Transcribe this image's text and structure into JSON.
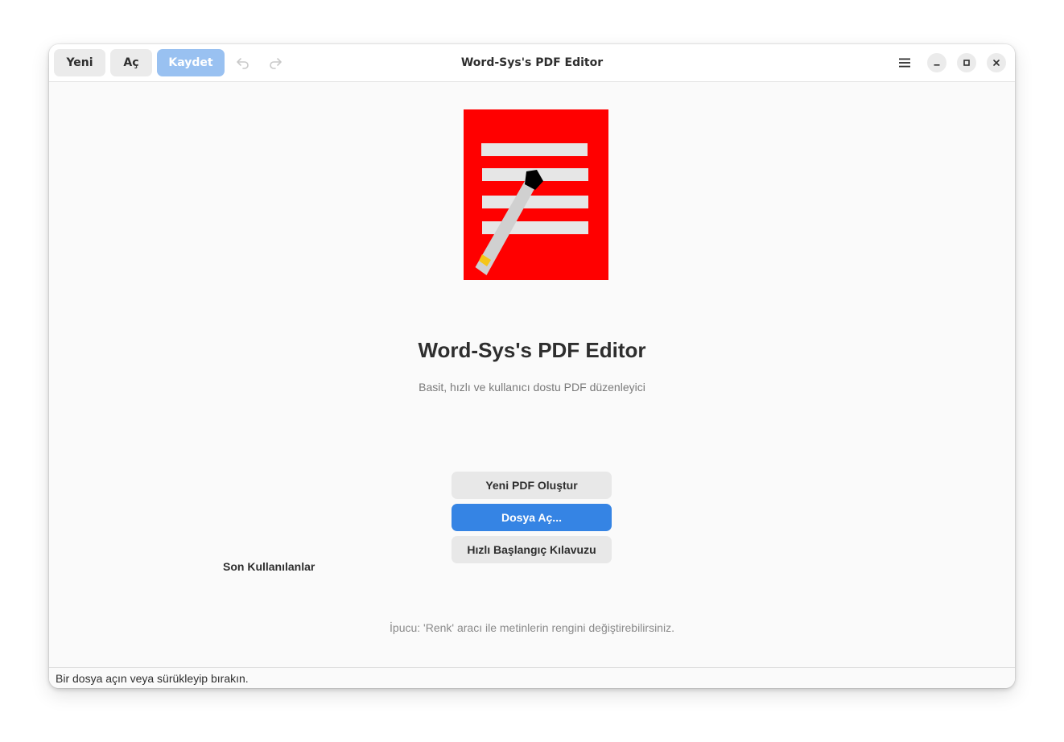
{
  "window": {
    "title": "Word-Sys's PDF Editor"
  },
  "toolbar": {
    "new_label": "Yeni",
    "open_label": "Aç",
    "save_label": "Kaydet"
  },
  "icons": {
    "undo": "undo-icon",
    "redo": "redo-icon",
    "menu": "hamburger-menu-icon",
    "minimize": "minimize-icon",
    "maximize": "maximize-icon",
    "close": "close-icon",
    "logo": "pdf-document-pen-logo"
  },
  "welcome": {
    "title": "Word-Sys's PDF Editor",
    "subtitle": "Basit, hızlı ve kullanıcı dostu PDF düzenleyici",
    "buttons": {
      "create": "Yeni PDF Oluştur",
      "open": "Dosya Aç...",
      "quickstart": "Hızlı Başlangıç Kılavuzu"
    },
    "recent_heading": "Son Kullanılanlar",
    "tip": "İpucu: 'Renk' aracı ile metinlerin rengini değiştirebilirsiniz."
  },
  "statusbar": {
    "text": "Bir dosya açın veya sürükleyip bırakın."
  },
  "colors": {
    "accent": "#3584e4",
    "suggested_disabled": "#99c1f1",
    "logo_background": "#ff0000",
    "logo_lines": "#e6e6e6",
    "pen_body": "#d0d0d0",
    "pen_tip": "#000000",
    "pen_eraser": "#f5c518"
  }
}
